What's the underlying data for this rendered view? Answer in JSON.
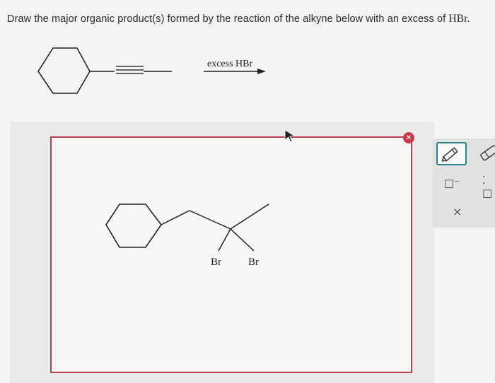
{
  "question": {
    "text": "Draw the major organic product(s) formed by the reaction of the alkyne below with an excess of",
    "reagent_formula": "HBr."
  },
  "reaction": {
    "arrow_label": "excess HBr"
  },
  "product": {
    "atom_labels": [
      "Br",
      "Br"
    ]
  },
  "tools": {
    "clear_symbol": "×",
    "minus_charge_symbol": "□⁻",
    "lone_pair_symbol": "⁚□",
    "delete_symbol": "×"
  },
  "colors": {
    "drawing_border": "#b8404c",
    "selected_tool_border": "#2f7f8c",
    "clear_button": "#c8394b"
  }
}
